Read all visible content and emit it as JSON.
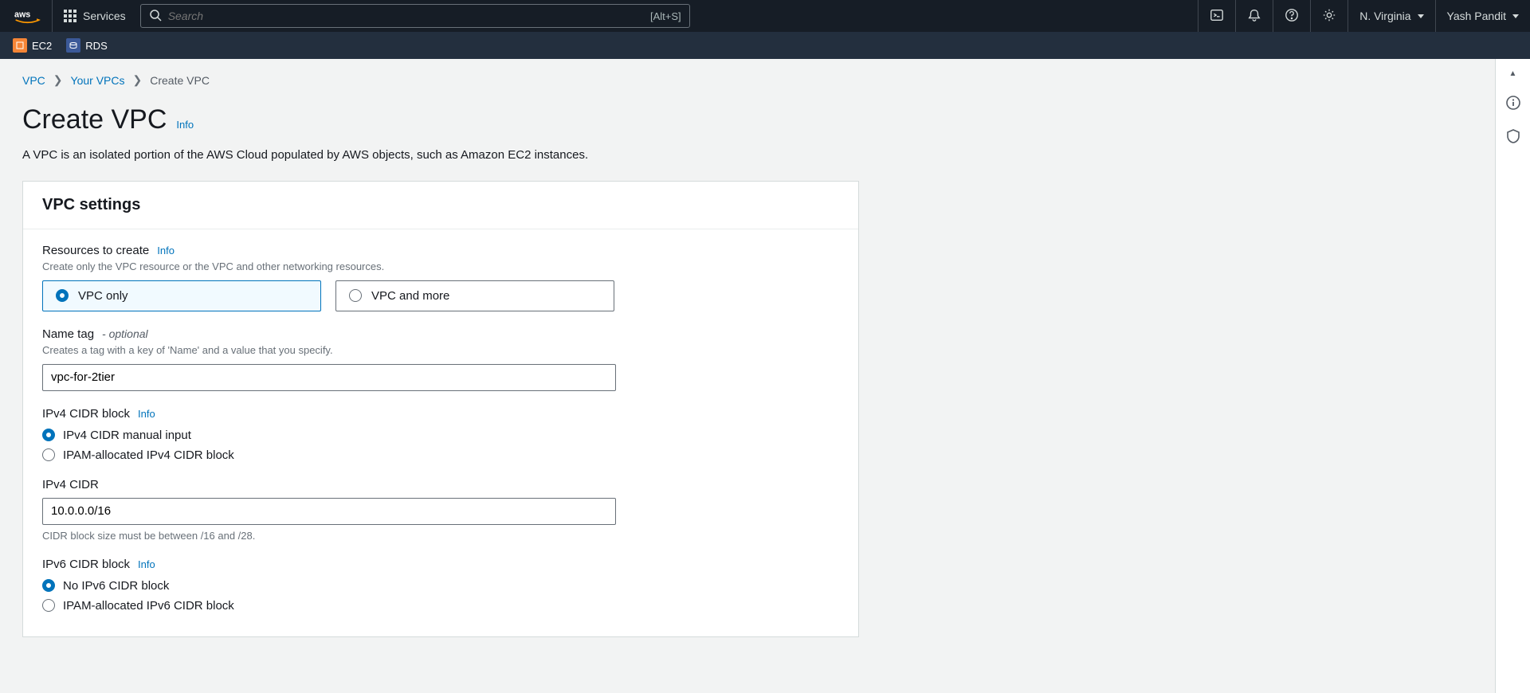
{
  "topnav": {
    "services_label": "Services",
    "search_placeholder": "Search",
    "search_shortcut": "[Alt+S]",
    "region": "N. Virginia",
    "user": "Yash Pandit"
  },
  "favorites": [
    {
      "label": "EC2"
    },
    {
      "label": "RDS"
    }
  ],
  "breadcrumbs": {
    "root": "VPC",
    "parent": "Your VPCs",
    "current": "Create VPC"
  },
  "header": {
    "title": "Create VPC",
    "info": "Info",
    "description": "A VPC is an isolated portion of the AWS Cloud populated by AWS objects, such as Amazon EC2 instances."
  },
  "panel": {
    "title": "VPC settings",
    "resources_to_create": {
      "label": "Resources to create",
      "info": "Info",
      "help": "Create only the VPC resource or the VPC and other networking resources.",
      "option1": "VPC only",
      "option2": "VPC and more"
    },
    "name_tag": {
      "label": "Name tag",
      "optional": " - optional",
      "help": "Creates a tag with a key of 'Name' and a value that you specify.",
      "value": "vpc-for-2tier"
    },
    "ipv4_block": {
      "label": "IPv4 CIDR block",
      "info": "Info",
      "option1": "IPv4 CIDR manual input",
      "option2": "IPAM-allocated IPv4 CIDR block"
    },
    "ipv4_cidr": {
      "label": "IPv4 CIDR",
      "value": "10.0.0.0/16",
      "help": "CIDR block size must be between /16 and /28."
    },
    "ipv6_block": {
      "label": "IPv6 CIDR block",
      "info": "Info",
      "option1": "No IPv6 CIDR block",
      "option2": "IPAM-allocated IPv6 CIDR block"
    }
  }
}
